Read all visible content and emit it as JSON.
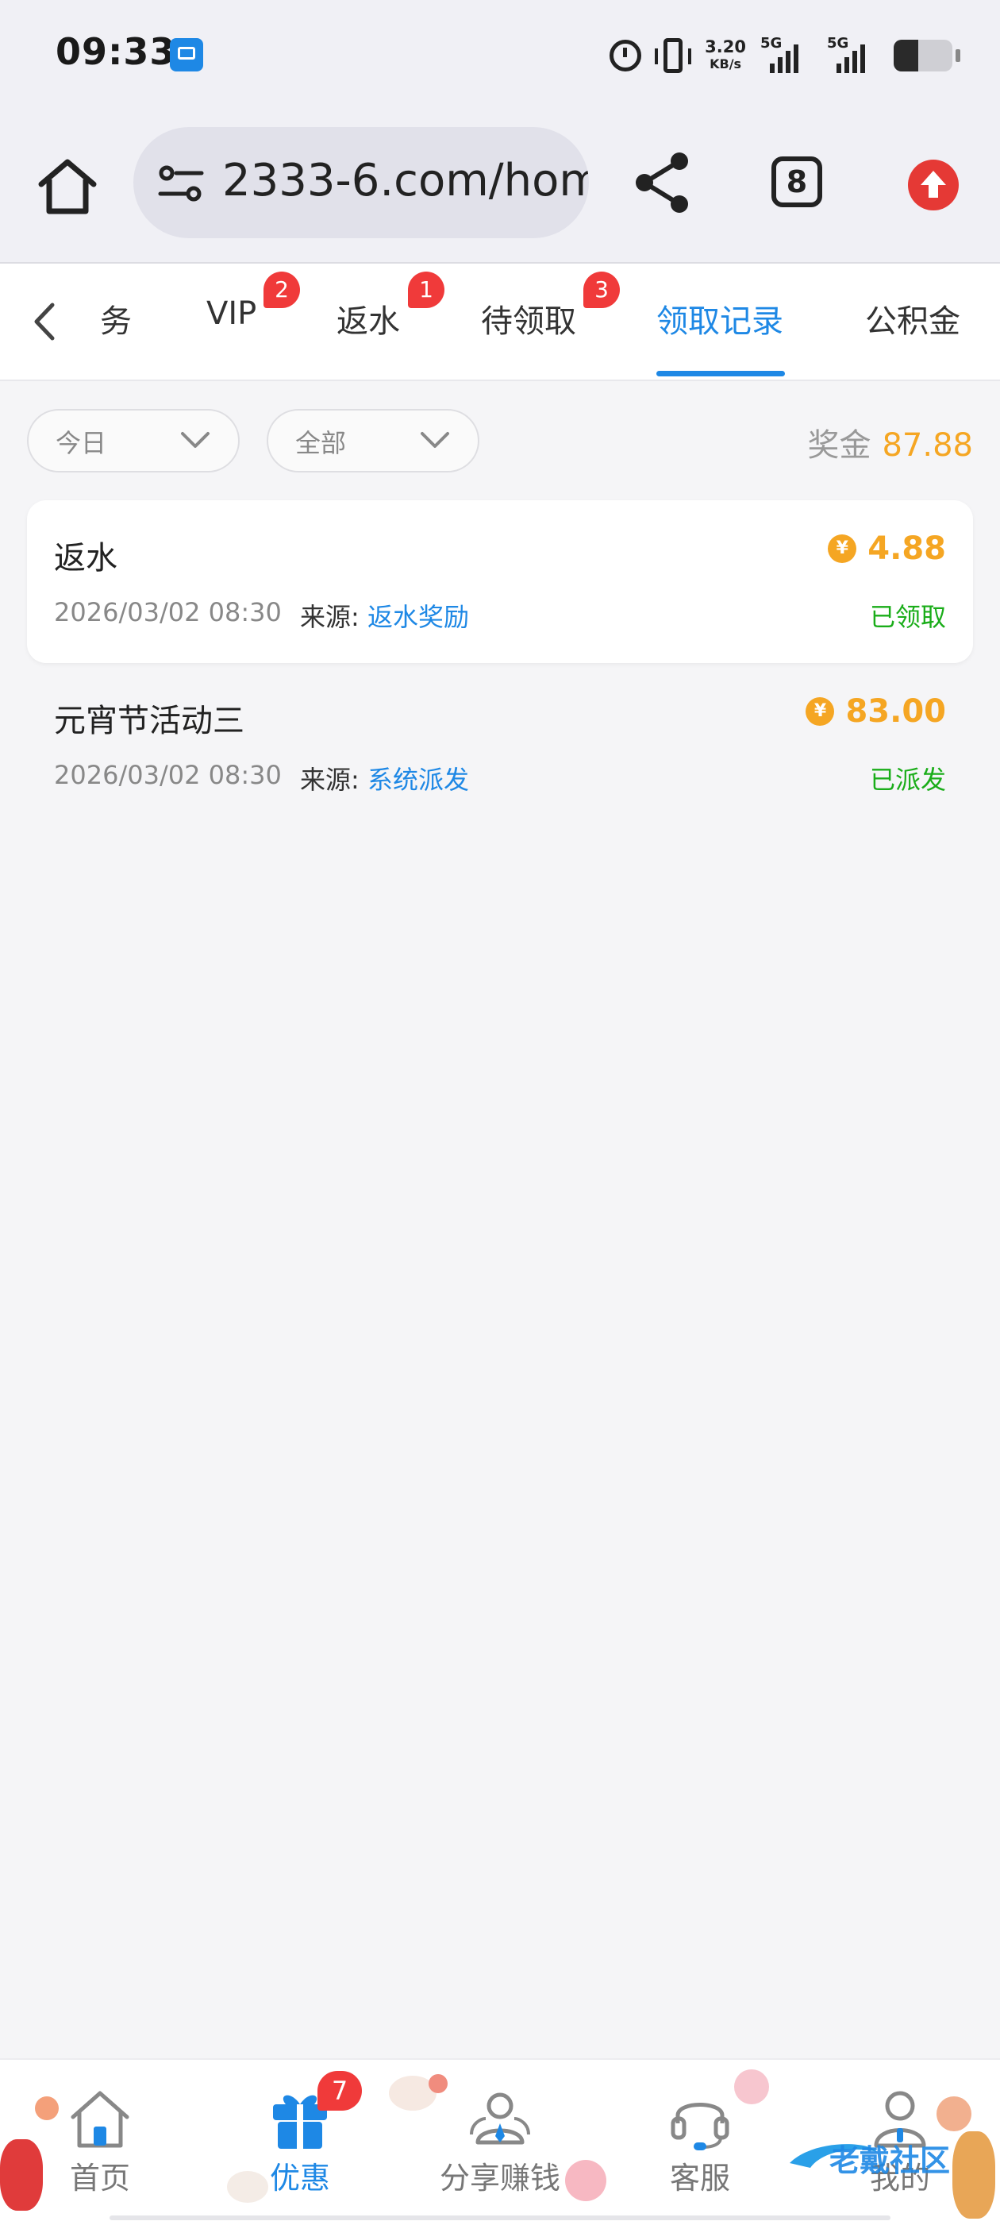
{
  "status_bar": {
    "time": "09:33",
    "net_speed_value": "3.20",
    "net_speed_unit": "KB/s",
    "signal_1_label": "5G",
    "signal_2_label": "5G"
  },
  "browser": {
    "url": "2333-6.com/hom",
    "tab_count": "8"
  },
  "category_tabs": {
    "items": [
      {
        "label": "务"
      },
      {
        "label": "VIP",
        "badge": "2"
      },
      {
        "label": "返水",
        "badge": "1"
      },
      {
        "label": "待领取",
        "badge": "3"
      },
      {
        "label": "领取记录"
      },
      {
        "label": "公积金"
      }
    ],
    "active_index": 4
  },
  "filters": {
    "date": "今日",
    "type": "全部",
    "bonus_label": "奖金",
    "bonus_value": "87.88"
  },
  "records": [
    {
      "title": "返水",
      "amount": "4.88",
      "date": "2026/03/02 08:30",
      "source_label": "来源:",
      "source_value": "返水奖励",
      "status": "已领取"
    },
    {
      "title": "元宵节活动三",
      "amount": "83.00",
      "date": "2026/03/02 08:30",
      "source_label": "来源:",
      "source_value": "系统派发",
      "status": "已派发"
    }
  ],
  "currency_symbol": "¥",
  "bottom_nav": {
    "items": [
      {
        "label": "首页",
        "icon": "home-icon"
      },
      {
        "label": "优惠",
        "icon": "gift-icon"
      },
      {
        "label": "分享赚钱",
        "icon": "share-earn-icon"
      },
      {
        "label": "客服",
        "icon": "headset-icon"
      },
      {
        "label": "我的",
        "icon": "profile-icon"
      }
    ],
    "active_index": 1,
    "promo_badge": "7"
  },
  "watermark": "老戴社区",
  "colors": {
    "accent": "#1e88e5",
    "amount": "#f5a623",
    "success": "#1aad19",
    "badge": "#f03a3a"
  }
}
